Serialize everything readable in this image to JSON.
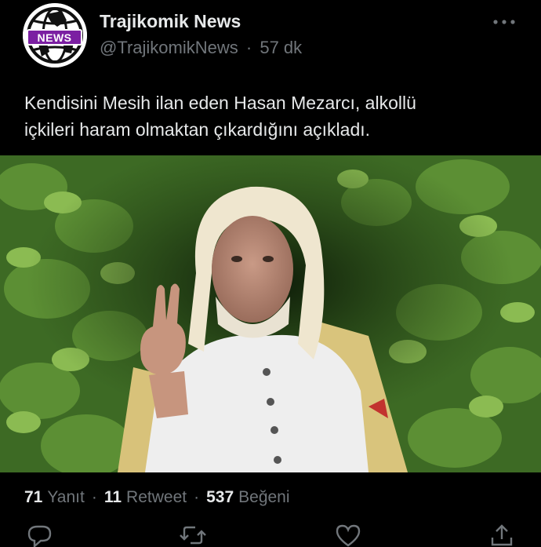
{
  "author": {
    "display_name": "Trajikomik News",
    "handle": "@TrajikomikNews",
    "separator": "·",
    "time_ago": "57 dk",
    "avatar_text": "NEWS"
  },
  "tweet": {
    "text": "Kendisini Mesih ilan eden Hasan Mezarcı, alkollü\niçkileri haram olmaktan çıkardığını açıkladı."
  },
  "stats": {
    "replies_count": "71",
    "replies_label": "Yanıt",
    "retweets_count": "11",
    "retweets_label": "Retweet",
    "likes_count": "537",
    "likes_label": "Beğeni",
    "separator": "·"
  },
  "icons": {
    "more": "more-dots-icon",
    "reply": "reply-icon",
    "retweet": "retweet-icon",
    "like": "heart-icon",
    "share": "share-icon"
  },
  "colors": {
    "background": "#000000",
    "primary_text": "#e7e9ea",
    "secondary_text": "#71767b",
    "avatar_badge": "#7b1fa2"
  }
}
